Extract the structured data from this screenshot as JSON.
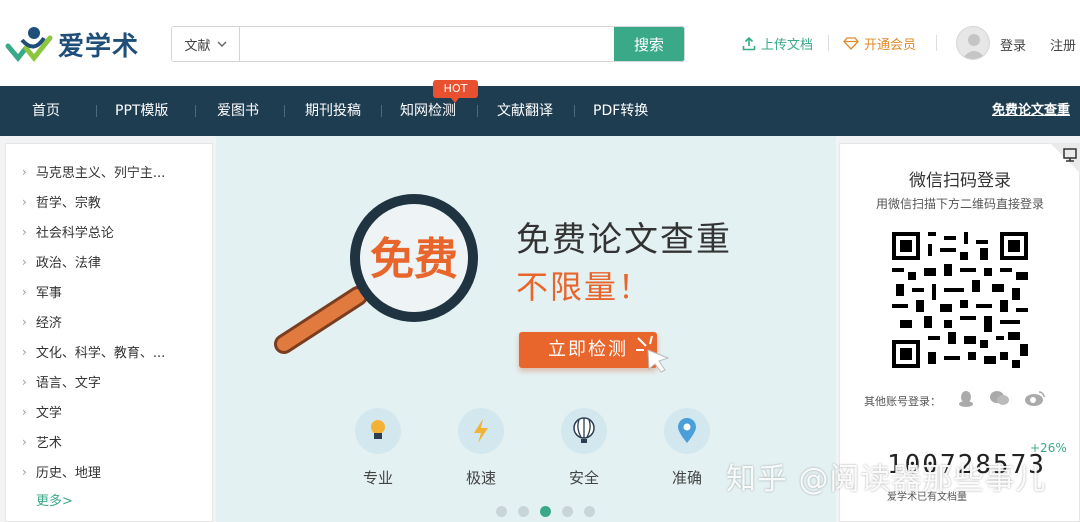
{
  "header": {
    "logo_text": "爱学术",
    "search_type": "文献",
    "search_placeholder": "",
    "search_button": "搜索",
    "upload_label": "上传文档",
    "vip_label": "开通会员",
    "login_label": "登录",
    "register_label": "注册"
  },
  "nav": {
    "items": [
      "首页",
      "PPT模版",
      "爱图书",
      "期刊投稿",
      "知网检测",
      "文献翻译",
      "PDF转换"
    ],
    "hot_badge": "HOT",
    "right_link": "免费论文查重"
  },
  "sidebar": {
    "categories": [
      "马克思主义、列宁主...",
      "哲学、宗教",
      "社会科学总论",
      "政治、法律",
      "军事",
      "经济",
      "文化、科学、教育、...",
      "语言、文字",
      "文学",
      "艺术",
      "历史、地理"
    ],
    "more": "更多>"
  },
  "banner": {
    "magnifier_text": "免费",
    "title": "免费论文查重",
    "subtitle": "不限量！",
    "cta": "立即检测",
    "features": [
      "专业",
      "极速",
      "安全",
      "准确"
    ],
    "dots_total": 5,
    "active_dot": 3
  },
  "qr_panel": {
    "title": "微信扫码登录",
    "subtitle": "用微信扫描下方二维码直接登录",
    "other_login": "其他账号登录：",
    "growth": "+26%",
    "count": "100728573",
    "count_label": "爱学术已有文档量"
  },
  "watermark": "知乎 @阅读器那些事儿",
  "colors": {
    "brand_green": "#3aa988",
    "nav_bg": "#1f3d51",
    "accent_orange": "#e8652b",
    "hot_red": "#e8502f"
  }
}
